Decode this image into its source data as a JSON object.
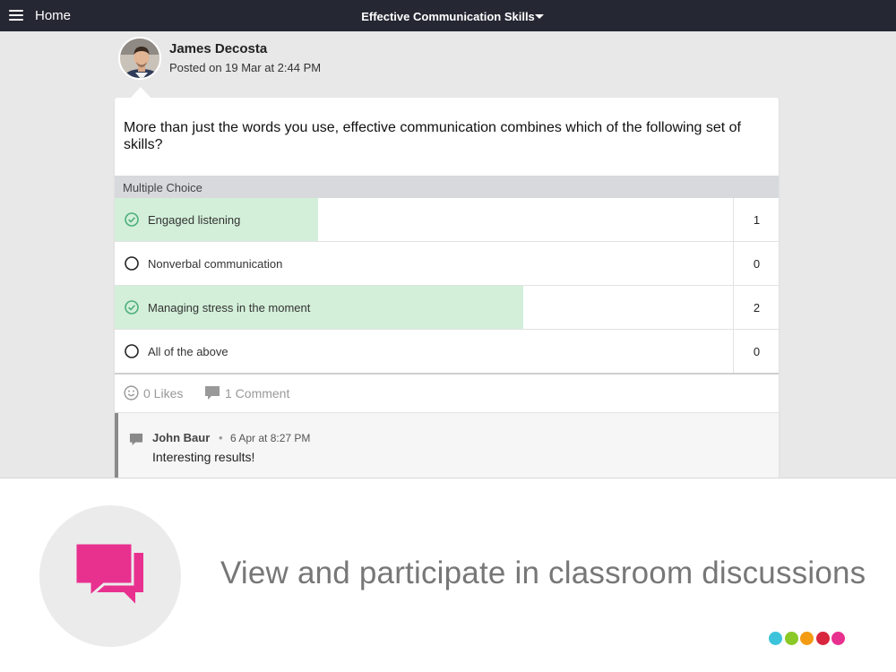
{
  "topbar": {
    "home_label": "Home",
    "course_title": "Effective Communication Skills",
    "menu_icon": "hamburger-menu-icon",
    "dropdown_icon": "caret-down-icon"
  },
  "post": {
    "author": "James Decosta",
    "posted_on": "Posted on 19 Mar at 2:44 PM",
    "question": "More than just the words you use, effective communication combines which of the following set of skills?",
    "type_label": "Multiple Choice",
    "choices": [
      {
        "label": "Engaged listening",
        "count": "1",
        "selected": true,
        "share": 0.33
      },
      {
        "label": "Nonverbal communication",
        "count": "0",
        "selected": false,
        "share": 0
      },
      {
        "label": "Managing stress in the moment",
        "count": "2",
        "selected": true,
        "share": 0.67
      },
      {
        "label": "All of the above",
        "count": "0",
        "selected": false,
        "share": 0
      }
    ],
    "likes_label": "0 Likes",
    "comments_label": "1 Comment"
  },
  "comment": {
    "author": "John Baur",
    "separator": "•",
    "time": "6 Apr at 8:27 PM",
    "text": "Interesting results!"
  },
  "banner": {
    "text": "View and participate in classroom discussions",
    "icon": "chat-bubbles-icon",
    "accent": "#e8308f",
    "dots": [
      "#3cc3dc",
      "#8ac926",
      "#f39c12",
      "#d7263d",
      "#e8308f"
    ]
  },
  "colors": {
    "topbar": "#252733",
    "selected_bar": "#d3efd9",
    "check_green": "#4caf7a"
  }
}
